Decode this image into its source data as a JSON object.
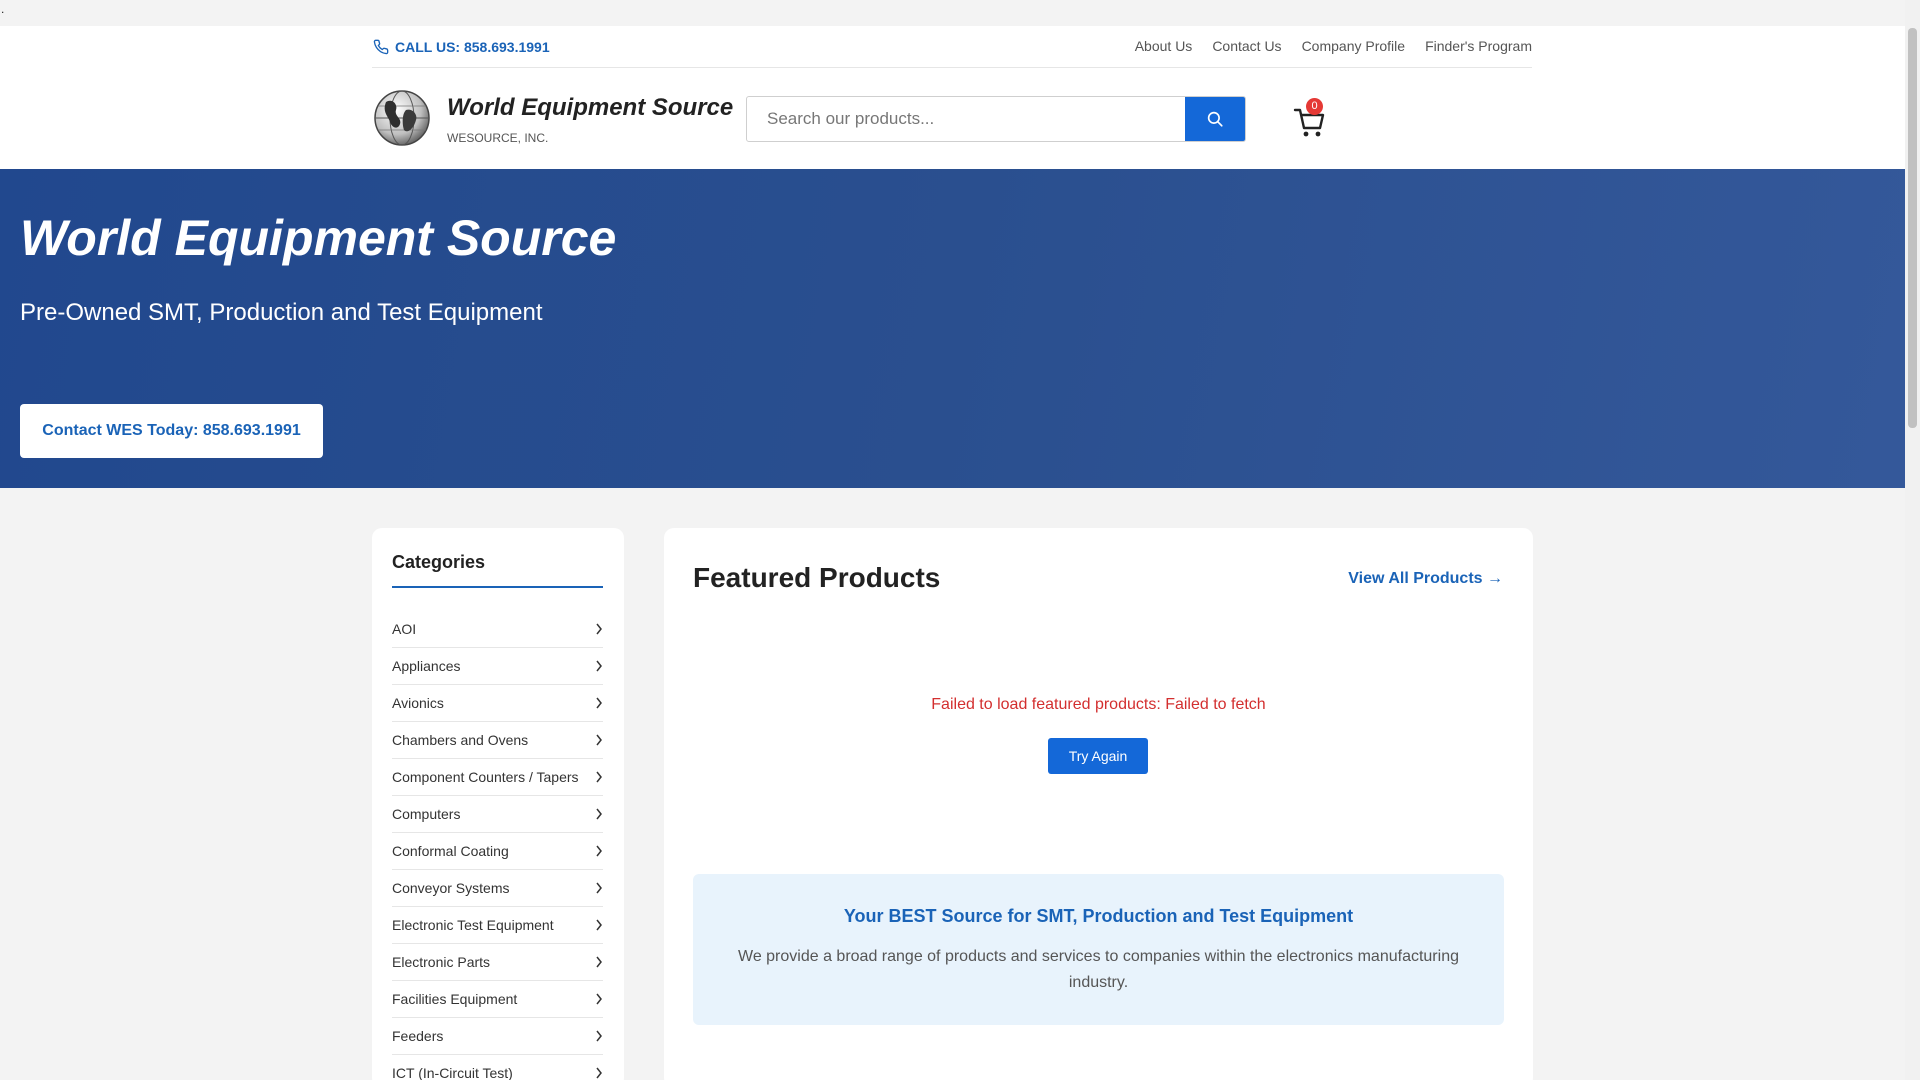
{
  "header": {
    "call_label": "CALL US: 858.693.1991",
    "nav": [
      "About Us",
      "Contact Us",
      "Company Profile",
      "Finder's Program"
    ],
    "brand_title": "World Equipment Source",
    "brand_sub": "WESOURCE, INC.",
    "search_placeholder": "Search our products...",
    "cart_count": "0"
  },
  "hero": {
    "title": "World Equipment Source",
    "subtitle": "Pre-Owned SMT, Production and Test Equipment",
    "cta": "Contact WES Today: 858.693.1991"
  },
  "sidebar": {
    "title": "Categories",
    "items": [
      "AOI",
      "Appliances",
      "Avionics",
      "Chambers and Ovens",
      "Component Counters / Tapers",
      "Computers",
      "Conformal Coating",
      "Conveyor Systems",
      "Electronic Test Equipment",
      "Electronic Parts",
      "Facilities Equipment",
      "Feeders",
      "ICT (In-Circuit Test)"
    ]
  },
  "main": {
    "title": "Featured Products",
    "view_all": "View All Products →",
    "error": "Failed to load featured products: Failed to fetch",
    "retry": "Try Again",
    "promo_title": "Your BEST Source for SMT, Production and Test Equipment",
    "promo_text": "We provide a broad range of products and services to companies within the electronics manufacturing industry."
  },
  "colors": {
    "accent": "#1468d8",
    "link": "#1a63b7",
    "hero_bg": "#2a4f8f",
    "error": "#d32f2f",
    "badge": "#e53935"
  },
  "icons": [
    "phone-icon",
    "globe-logo",
    "search-icon",
    "cart-icon",
    "chevron-right-icon"
  ]
}
